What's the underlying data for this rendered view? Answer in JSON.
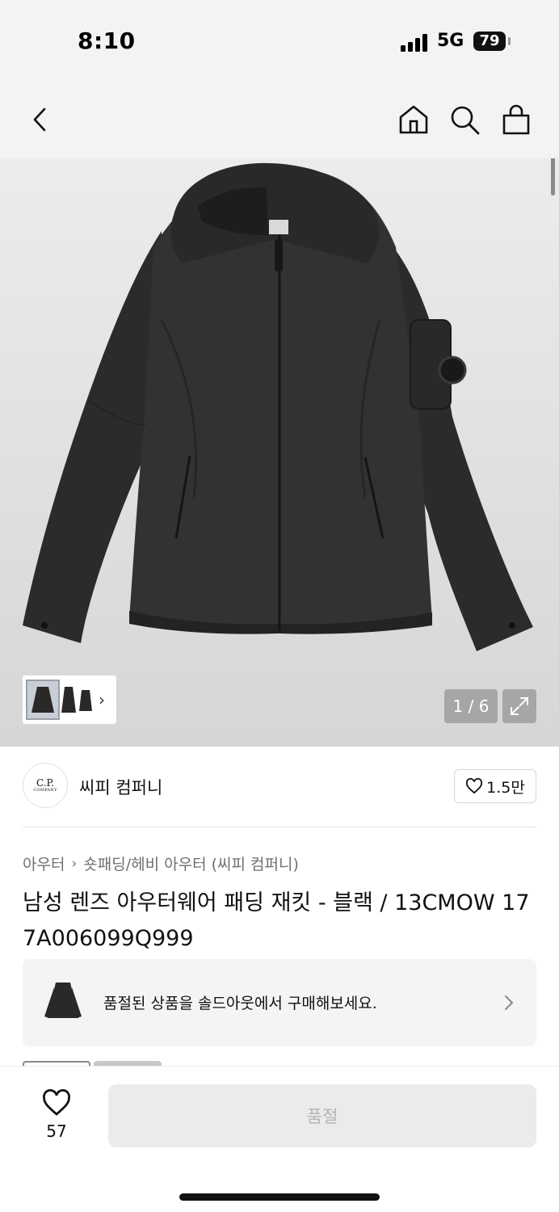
{
  "status_bar": {
    "time": "8:10",
    "network": "5G",
    "battery": "79"
  },
  "gallery": {
    "counter": "1 / 6"
  },
  "brand": {
    "logo_line1": "C.P.",
    "logo_line2": "COMPANY",
    "name": "씨피 컴퍼니",
    "likes": "1.5만"
  },
  "breadcrumb": {
    "level1": "아우터",
    "level2": "숏패딩/헤비 아우터 (씨피 컴퍼니)"
  },
  "product": {
    "title": "남성 렌즈 아우터웨어 패딩 재킷 - 블랙 / 13CMOW 177A006099Q999"
  },
  "soldout_banner": {
    "text": "품절된 상품을 솔드아웃에서 구매해보세요."
  },
  "bottom_bar": {
    "wish_count": "57",
    "buy_label": "품절"
  },
  "colors": {
    "background": "#ffffff",
    "nav": "#f3f3f3",
    "disabled": "#ebebeb",
    "jacket": "#2f2e2d"
  }
}
